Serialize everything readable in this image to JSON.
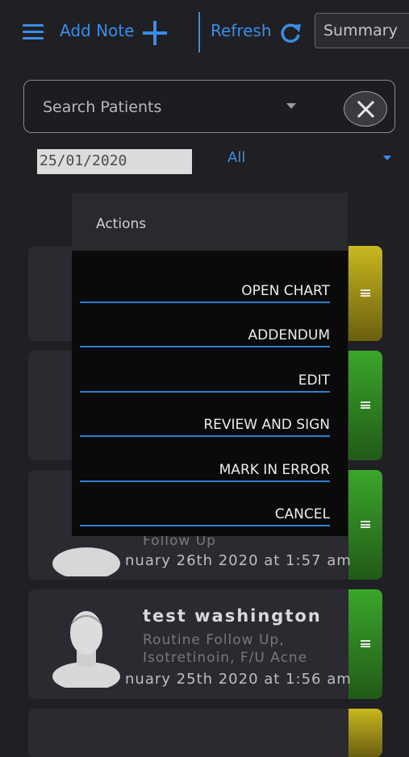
{
  "toolbar": {
    "menu_icon": "hamburger-icon",
    "add_note_label": "Add Note",
    "add_icon": "plus-icon",
    "refresh_label": "Refresh",
    "refresh_icon": "refresh-icon",
    "summary_label": "Summary"
  },
  "search": {
    "placeholder": "Search Patients",
    "dropdown_icon": "caret-down-icon",
    "clear_icon": "close-icon"
  },
  "filters": {
    "date_value": "25/01/2020",
    "type_value": "All"
  },
  "actions_menu": {
    "title": "Actions",
    "items": [
      "OPEN CHART",
      "ADDENDUM",
      "EDIT",
      "REVIEW AND SIGN",
      "MARK IN ERROR",
      "CANCEL"
    ]
  },
  "appointments": [
    {
      "status_color": "#c8b81e",
      "name": "",
      "reason_lines": [],
      "time": ""
    },
    {
      "status_color": "#3aa62a",
      "name": "",
      "reason_lines": [],
      "time": ""
    },
    {
      "status_color": "#3aa62a",
      "name": "",
      "reason_lines": [
        "Follow Up"
      ],
      "time": "nuary 26th 2020 at 1:57 am"
    },
    {
      "status_color": "#3aa62a",
      "name": "test washington",
      "reason_lines": [
        "Routine Follow Up,",
        "Isotretinoin, F/U Acne"
      ],
      "time": "nuary 25th 2020 at 1:56 am"
    },
    {
      "status_color": "#c8b81e",
      "name": "",
      "reason_lines": [],
      "time": ""
    }
  ],
  "colors": {
    "accent": "#3a8ee6",
    "background": "#1f1f24",
    "card": "#2a2a30",
    "status_yellow": "#c8b81e",
    "status_green": "#3aa62a"
  }
}
